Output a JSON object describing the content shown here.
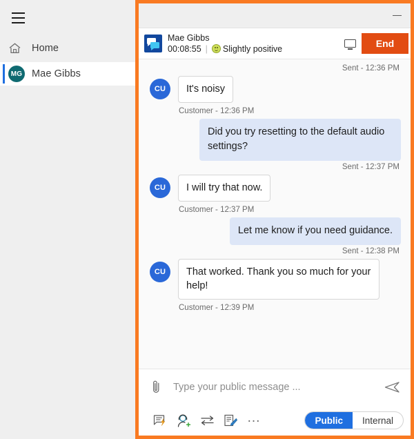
{
  "colors": {
    "window_border": "#f97a22",
    "accent_blue": "#1f6fe0",
    "end_button": "#e24c12",
    "agent_bubble": "#dde6f7",
    "customer_avatar": "#2a68d8",
    "nav_avatar": "#0f6a71"
  },
  "sidebar": {
    "menu_icon": "hamburger-icon",
    "items": [
      {
        "icon": "home-icon",
        "label": "Home",
        "selected": false
      },
      {
        "icon": "avatar",
        "initials": "MG",
        "label": "Mae Gibbs",
        "selected": true
      }
    ]
  },
  "chat_window": {
    "titlebar": {
      "minimize_label": "minimize-icon"
    },
    "header": {
      "icon": "chat-bubbles-icon",
      "customer_name": "Mae Gibbs",
      "timer": "00:08:55",
      "separator": "|",
      "sentiment_icon": "slightly-positive-face-icon",
      "sentiment_label": "Slightly positive",
      "monitor_icon": "monitor-icon",
      "end_label": "End"
    },
    "messages": [
      {
        "direction": "outgoing-status",
        "status": "Sent - 12:36 PM"
      },
      {
        "direction": "incoming",
        "avatar_initials": "CU",
        "text": "It's noisy",
        "meta": "Customer - 12:36 PM"
      },
      {
        "direction": "outgoing",
        "text": "Did you try resetting to the default audio settings?",
        "status": "Sent - 12:37 PM"
      },
      {
        "direction": "incoming",
        "avatar_initials": "CU",
        "text": "I will try that now.",
        "meta": "Customer - 12:37 PM"
      },
      {
        "direction": "outgoing",
        "text": "Let me know if you need guidance.",
        "status": "Sent - 12:38 PM"
      },
      {
        "direction": "incoming",
        "avatar_initials": "CU",
        "text": "That worked. Thank you so much for your help!",
        "meta": "Customer - 12:39 PM"
      }
    ],
    "composer": {
      "attach_icon": "paperclip-icon",
      "input_value": "",
      "input_placeholder": "Type your public message ...",
      "send_icon": "send-paper-plane-icon",
      "tools": [
        {
          "icon": "quick-reply-icon"
        },
        {
          "icon": "add-agent-icon"
        },
        {
          "icon": "transfer-icon"
        },
        {
          "icon": "notes-icon"
        },
        {
          "icon": "more-options-icon",
          "label": "..."
        }
      ],
      "visibility_toggle": {
        "selected": "Public",
        "options": [
          "Public",
          "Internal"
        ]
      }
    }
  }
}
